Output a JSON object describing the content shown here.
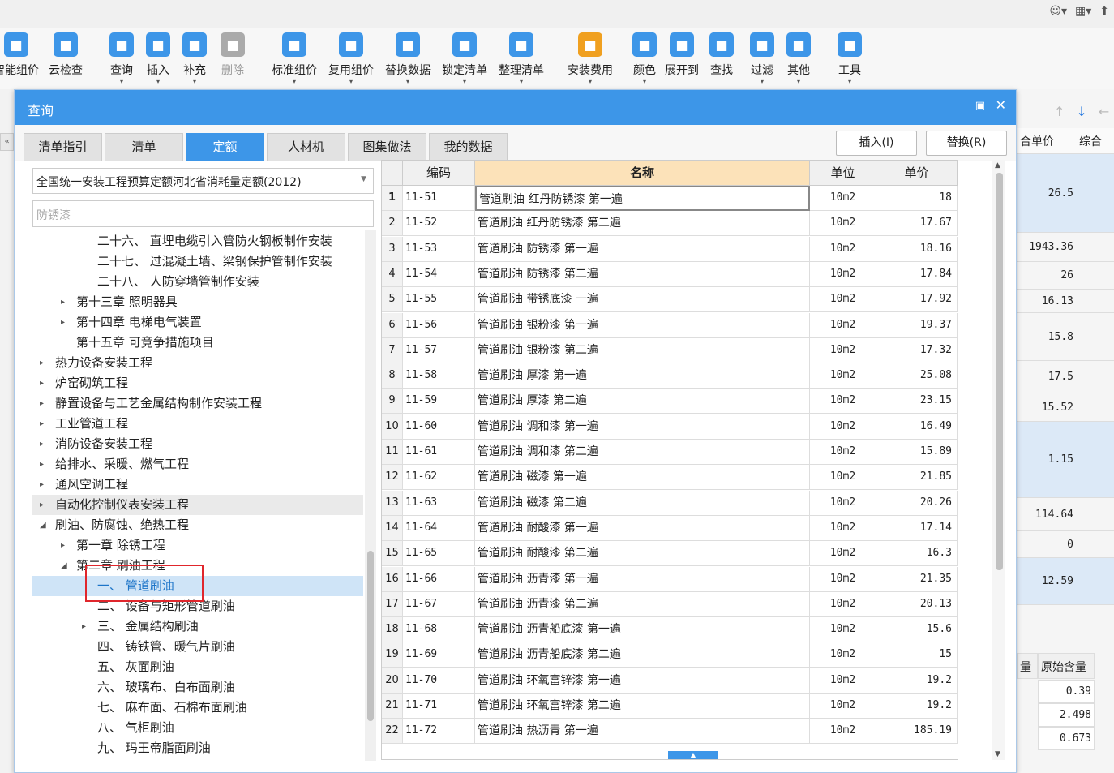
{
  "ribbon": {
    "items": [
      {
        "label": "智能组价",
        "icon": "smart-pricing-icon",
        "color": "#3d96e8",
        "disabled": false
      },
      {
        "label": "云检查",
        "icon": "cloud-check-icon",
        "color": "#3d96e8",
        "disabled": false
      },
      {
        "label": "查询",
        "icon": "query-icon",
        "color": "#3d96e8",
        "disabled": false
      },
      {
        "label": "插入",
        "icon": "insert-icon",
        "color": "#3d96e8",
        "disabled": false
      },
      {
        "label": "补充",
        "icon": "supplement-icon",
        "color": "#3d96e8",
        "disabled": false
      },
      {
        "label": "删除",
        "icon": "delete-icon",
        "color": "#aaaaaa",
        "disabled": true
      },
      {
        "label": "标准组价",
        "icon": "standard-pricing-icon",
        "color": "#3d96e8",
        "disabled": false
      },
      {
        "label": "复用组价",
        "icon": "reuse-pricing-icon",
        "color": "#3d96e8",
        "disabled": false
      },
      {
        "label": "替换数据",
        "icon": "replace-data-icon",
        "color": "#3d96e8",
        "disabled": false
      },
      {
        "label": "锁定清单",
        "icon": "lock-list-icon",
        "color": "#3d96e8",
        "disabled": false
      },
      {
        "label": "整理清单",
        "icon": "organize-list-icon",
        "color": "#3d96e8",
        "disabled": false
      },
      {
        "label": "安装费用",
        "icon": "install-cost-icon",
        "color": "#f0a020",
        "disabled": false
      },
      {
        "label": "颜色",
        "icon": "color-icon",
        "color": "#3d96e8",
        "disabled": false
      },
      {
        "label": "展开到",
        "icon": "expand-to-icon",
        "color": "#3d96e8",
        "disabled": false
      },
      {
        "label": "查找",
        "icon": "find-icon",
        "color": "#3d96e8",
        "disabled": false
      },
      {
        "label": "过滤",
        "icon": "filter-icon",
        "color": "#3d96e8",
        "disabled": false
      },
      {
        "label": "其他",
        "icon": "other-icon",
        "color": "#3d96e8",
        "disabled": false
      },
      {
        "label": "工具",
        "icon": "tools-icon",
        "color": "#3d96e8",
        "disabled": false
      }
    ]
  },
  "dialog": {
    "title": "查询",
    "tabs": [
      "清单指引",
      "清单",
      "定额",
      "人材机",
      "图集做法",
      "我的数据"
    ],
    "active_tab": 2,
    "insert_button": "插入(I)",
    "replace_button": "替换(R)",
    "quota_library": "全国统一安装工程预算定额河北省消耗量定额(2012)",
    "search_value": "防锈漆",
    "tree": [
      {
        "label": "二十六、 直埋电缆引入管防火钢板制作安装",
        "level": 3,
        "expand": "",
        "state": ""
      },
      {
        "label": "二十七、 过混凝土墙、梁钢保护管制作安装",
        "level": 3,
        "expand": "",
        "state": ""
      },
      {
        "label": "二十八、 人防穿墙管制作安装",
        "level": 3,
        "expand": "",
        "state": ""
      },
      {
        "label": "第十三章 照明器具",
        "level": 2,
        "expand": "▸",
        "state": ""
      },
      {
        "label": "第十四章 电梯电气装置",
        "level": 2,
        "expand": "▸",
        "state": ""
      },
      {
        "label": "第十五章 可竞争措施项目",
        "level": 2,
        "expand": "",
        "state": ""
      },
      {
        "label": "热力设备安装工程",
        "level": 1,
        "expand": "▸",
        "state": ""
      },
      {
        "label": "炉窑砌筑工程",
        "level": 1,
        "expand": "▸",
        "state": ""
      },
      {
        "label": "静置设备与工艺金属结构制作安装工程",
        "level": 1,
        "expand": "▸",
        "state": ""
      },
      {
        "label": "工业管道工程",
        "level": 1,
        "expand": "▸",
        "state": ""
      },
      {
        "label": "消防设备安装工程",
        "level": 1,
        "expand": "▸",
        "state": ""
      },
      {
        "label": "给排水、采暖、燃气工程",
        "level": 1,
        "expand": "▸",
        "state": ""
      },
      {
        "label": "通风空调工程",
        "level": 1,
        "expand": "▸",
        "state": ""
      },
      {
        "label": "自动化控制仪表安装工程",
        "level": 1,
        "expand": "▸",
        "state": "hover"
      },
      {
        "label": "刷油、防腐蚀、绝热工程",
        "level": 1,
        "expand": "◢",
        "state": ""
      },
      {
        "label": "第一章 除锈工程",
        "level": 2,
        "expand": "▸",
        "state": ""
      },
      {
        "label": "第二章 刷油工程",
        "level": 2,
        "expand": "◢",
        "state": ""
      },
      {
        "label": "一、 管道刷油",
        "level": 3,
        "expand": "",
        "state": "selected"
      },
      {
        "label": "二、 设备与矩形管道刷油",
        "level": 3,
        "expand": "",
        "state": ""
      },
      {
        "label": "三、 金属结构刷油",
        "level": 3,
        "expand": "▸",
        "state": ""
      },
      {
        "label": "四、 铸铁管、暖气片刷油",
        "level": 3,
        "expand": "",
        "state": ""
      },
      {
        "label": "五、 灰面刷油",
        "level": 3,
        "expand": "",
        "state": ""
      },
      {
        "label": "六、 玻璃布、白布面刷油",
        "level": 3,
        "expand": "",
        "state": ""
      },
      {
        "label": "七、 麻布面、石棉布面刷油",
        "level": 3,
        "expand": "",
        "state": ""
      },
      {
        "label": "八、 气柜刷油",
        "level": 3,
        "expand": "",
        "state": ""
      },
      {
        "label": "九、 玛王帝脂面刷油",
        "level": 3,
        "expand": "",
        "state": ""
      }
    ],
    "table": {
      "headers": [
        "",
        "编码",
        "名称",
        "单位",
        "单价"
      ],
      "rows": [
        [
          "1",
          "11-51",
          "管道刷油 红丹防锈漆 第一遍",
          "10m2",
          "18"
        ],
        [
          "2",
          "11-52",
          "管道刷油 红丹防锈漆 第二遍",
          "10m2",
          "17.67"
        ],
        [
          "3",
          "11-53",
          "管道刷油 防锈漆 第一遍",
          "10m2",
          "18.16"
        ],
        [
          "4",
          "11-54",
          "管道刷油 防锈漆 第二遍",
          "10m2",
          "17.84"
        ],
        [
          "5",
          "11-55",
          "管道刷油 带锈底漆 一遍",
          "10m2",
          "17.92"
        ],
        [
          "6",
          "11-56",
          "管道刷油 银粉漆 第一遍",
          "10m2",
          "19.37"
        ],
        [
          "7",
          "11-57",
          "管道刷油 银粉漆 第二遍",
          "10m2",
          "17.32"
        ],
        [
          "8",
          "11-58",
          "管道刷油 厚漆 第一遍",
          "10m2",
          "25.08"
        ],
        [
          "9",
          "11-59",
          "管道刷油 厚漆 第二遍",
          "10m2",
          "23.15"
        ],
        [
          "10",
          "11-60",
          "管道刷油 调和漆 第一遍",
          "10m2",
          "16.49"
        ],
        [
          "11",
          "11-61",
          "管道刷油 调和漆 第二遍",
          "10m2",
          "15.89"
        ],
        [
          "12",
          "11-62",
          "管道刷油 磁漆 第一遍",
          "10m2",
          "21.85"
        ],
        [
          "13",
          "11-63",
          "管道刷油 磁漆 第二遍",
          "10m2",
          "20.26"
        ],
        [
          "14",
          "11-64",
          "管道刷油 耐酸漆 第一遍",
          "10m2",
          "17.14"
        ],
        [
          "15",
          "11-65",
          "管道刷油 耐酸漆 第二遍",
          "10m2",
          "16.3"
        ],
        [
          "16",
          "11-66",
          "管道刷油 沥青漆 第一遍",
          "10m2",
          "21.35"
        ],
        [
          "17",
          "11-67",
          "管道刷油 沥青漆 第二遍",
          "10m2",
          "20.13"
        ],
        [
          "18",
          "11-68",
          "管道刷油 沥青船底漆 第一遍",
          "10m2",
          "15.6"
        ],
        [
          "19",
          "11-69",
          "管道刷油 沥青船底漆 第二遍",
          "10m2",
          "15"
        ],
        [
          "20",
          "11-70",
          "管道刷油 环氧富锌漆 第一遍",
          "10m2",
          "19.2"
        ],
        [
          "21",
          "11-71",
          "管道刷油 环氧富锌漆 第二遍",
          "10m2",
          "19.2"
        ],
        [
          "22",
          "11-72",
          "管道刷油 热沥青 第一遍",
          "10m2",
          "185.19"
        ]
      ]
    }
  },
  "background": {
    "col_headers": [
      "合单价",
      "综合"
    ],
    "values": [
      "26.5",
      "1943.36",
      "26",
      "16.13",
      "15.8",
      "17.5",
      "15.52",
      "1.15",
      "114.64",
      "0",
      "12.59"
    ],
    "sub_headers": [
      "量",
      "原始含量"
    ],
    "sub_values": [
      "0.39",
      "2.498",
      "0.673"
    ]
  }
}
